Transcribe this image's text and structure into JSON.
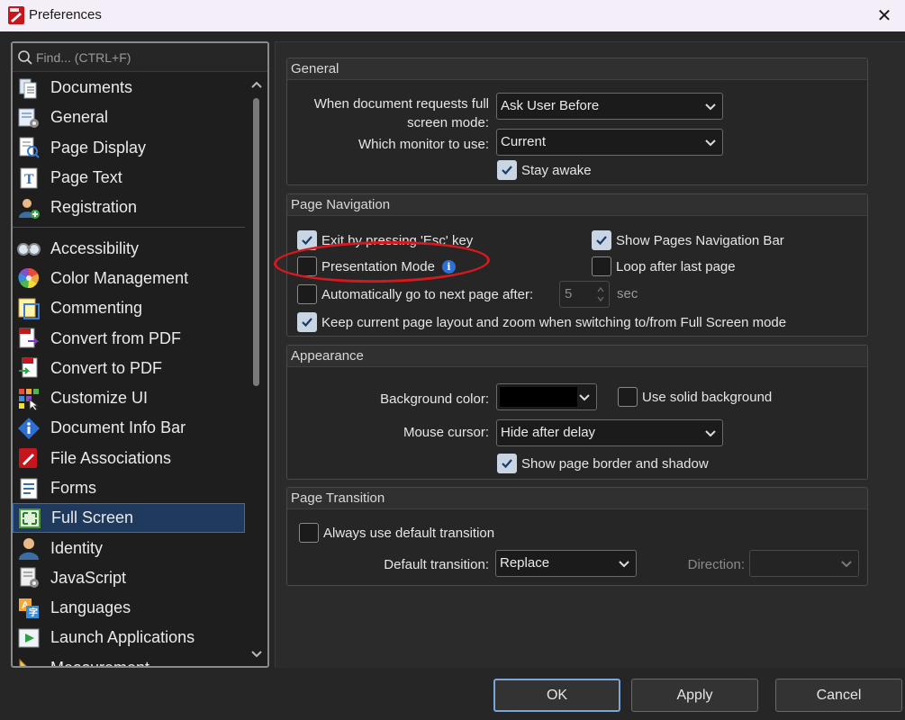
{
  "window": {
    "title": "Preferences",
    "close_symbol": "✕"
  },
  "search": {
    "placeholder": "Find... (CTRL+F)"
  },
  "nav": {
    "items": [
      {
        "label": "Documents",
        "icon": "documents-icon"
      },
      {
        "label": "General",
        "icon": "general-icon"
      },
      {
        "label": "Page Display",
        "icon": "page-display-icon"
      },
      {
        "label": "Page Text",
        "icon": "page-text-icon"
      },
      {
        "label": "Registration",
        "icon": "registration-icon"
      },
      {
        "label": "Accessibility",
        "icon": "accessibility-icon"
      },
      {
        "label": "Color Management",
        "icon": "color-management-icon"
      },
      {
        "label": "Commenting",
        "icon": "commenting-icon"
      },
      {
        "label": "Convert from PDF",
        "icon": "convert-from-pdf-icon"
      },
      {
        "label": "Convert to PDF",
        "icon": "convert-to-pdf-icon"
      },
      {
        "label": "Customize UI",
        "icon": "customize-ui-icon"
      },
      {
        "label": "Document Info Bar",
        "icon": "document-info-bar-icon"
      },
      {
        "label": "File Associations",
        "icon": "file-associations-icon"
      },
      {
        "label": "Forms",
        "icon": "forms-icon"
      },
      {
        "label": "Full Screen",
        "icon": "full-screen-icon"
      },
      {
        "label": "Identity",
        "icon": "identity-icon"
      },
      {
        "label": "JavaScript",
        "icon": "javascript-icon"
      },
      {
        "label": "Languages",
        "icon": "languages-icon"
      },
      {
        "label": "Launch Applications",
        "icon": "launch-applications-icon"
      },
      {
        "label": "Measurement",
        "icon": "measurement-icon"
      }
    ],
    "selected": "Full Screen"
  },
  "general": {
    "title": "General",
    "fullscreen_label_1": "When document requests full",
    "fullscreen_label_2": "screen mode:",
    "fullscreen_value": "Ask User Before",
    "monitor_label": "Which monitor to use:",
    "monitor_value": "Current",
    "stay_awake": "Stay awake",
    "stay_awake_checked": true
  },
  "page_navigation": {
    "title": "Page Navigation",
    "exit_esc": "Exit by pressing 'Esc' key",
    "exit_esc_checked": true,
    "show_nav_bar": "Show Pages Navigation Bar",
    "show_nav_bar_checked": true,
    "presentation_mode": "Presentation Mode",
    "presentation_mode_checked": false,
    "info_glyph": "i",
    "loop": "Loop after last page",
    "loop_checked": false,
    "auto_next": "Automatically go to next page after:",
    "auto_next_checked": false,
    "auto_next_value": "5",
    "auto_next_unit": "sec",
    "keep_layout": "Keep current page layout and zoom when switching to/from Full Screen mode",
    "keep_layout_checked": true
  },
  "appearance": {
    "title": "Appearance",
    "bg_color_label": "Background color:",
    "bg_color_value": "#000000",
    "solid_bg": "Use solid background",
    "solid_bg_checked": false,
    "cursor_label": "Mouse cursor:",
    "cursor_value": "Hide after delay",
    "border_shadow": "Show page border and shadow",
    "border_shadow_checked": true
  },
  "page_transition": {
    "title": "Page Transition",
    "always_default": "Always use default transition",
    "always_default_checked": false,
    "default_label": "Default transition:",
    "default_value": "Replace",
    "direction_label": "Direction:",
    "direction_value": ""
  },
  "footer": {
    "ok": "OK",
    "apply": "Apply",
    "cancel": "Cancel"
  },
  "colors": {
    "accent": "#3a6ea5",
    "annotation": "#d5191f",
    "selected_bg": "#1f3a5c"
  }
}
